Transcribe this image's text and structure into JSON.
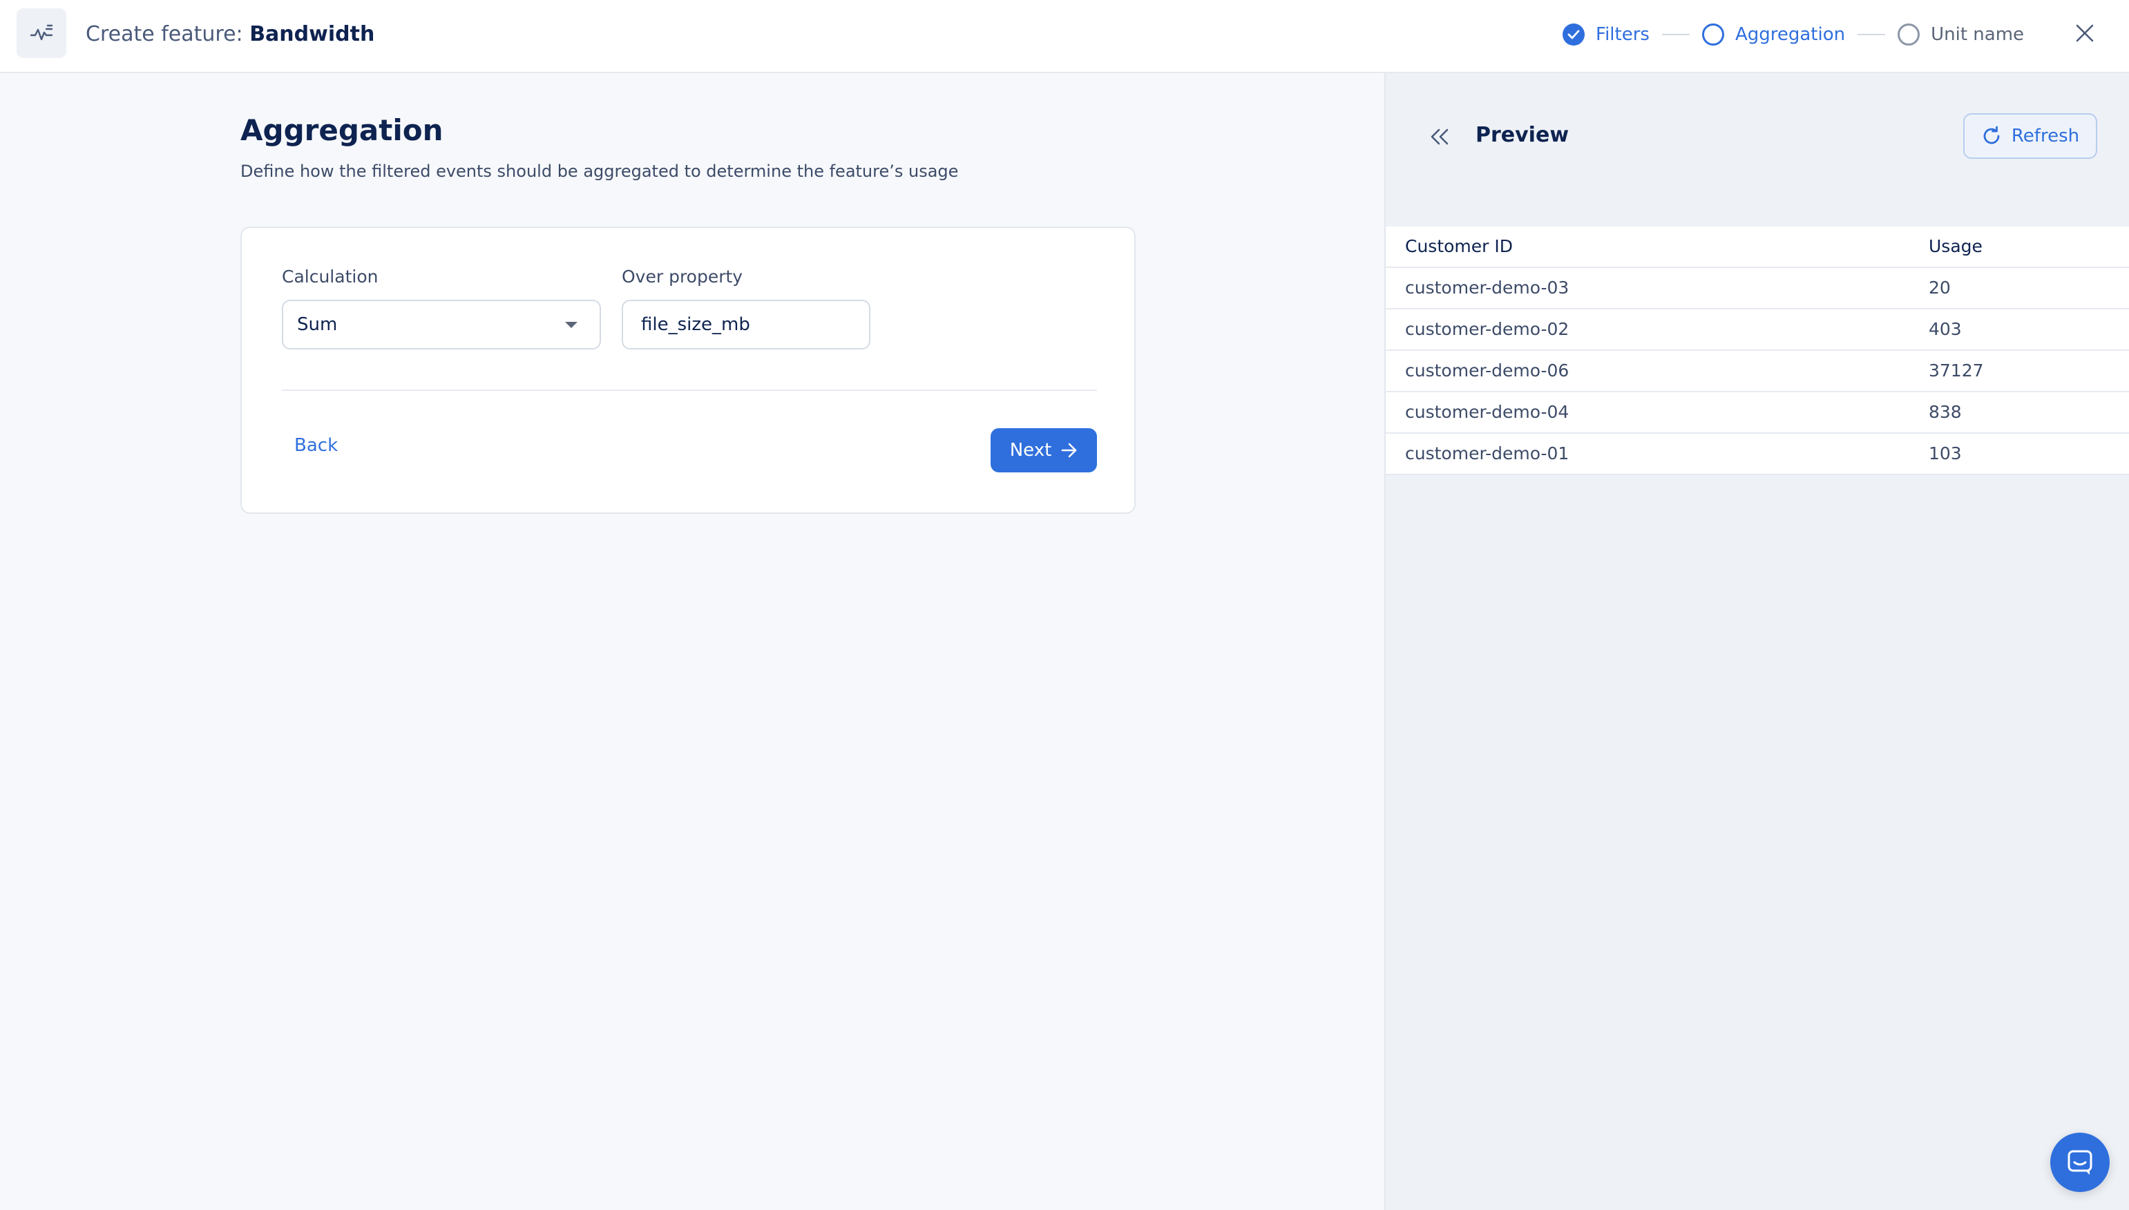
{
  "header": {
    "title_prefix": "Create feature: ",
    "feature_name": "Bandwidth",
    "steps": [
      {
        "label": "Filters",
        "state": "done"
      },
      {
        "label": "Aggregation",
        "state": "active"
      },
      {
        "label": "Unit name",
        "state": "todo"
      }
    ],
    "icons": {
      "logo": "activity-sparkline-icon",
      "close": "close-icon"
    }
  },
  "main": {
    "title": "Aggregation",
    "subtitle": "Define how the filtered events should be aggregated to determine the feature’s usage",
    "calculation_label": "Calculation",
    "calculation_value": "Sum",
    "property_label": "Over property",
    "property_value": "file_size_mb",
    "back_label": "Back",
    "next_label": "Next"
  },
  "preview": {
    "title": "Preview",
    "refresh_label": "Refresh",
    "columns": [
      "Customer ID",
      "Usage"
    ],
    "rows": [
      [
        "customer-demo-03",
        "20"
      ],
      [
        "customer-demo-02",
        "403"
      ],
      [
        "customer-demo-06",
        "37127"
      ],
      [
        "customer-demo-04",
        "838"
      ],
      [
        "customer-demo-01",
        "103"
      ]
    ]
  },
  "colors": {
    "accent": "#2f6fdd",
    "text": "#0e2350",
    "background": "#f6f8fb"
  }
}
